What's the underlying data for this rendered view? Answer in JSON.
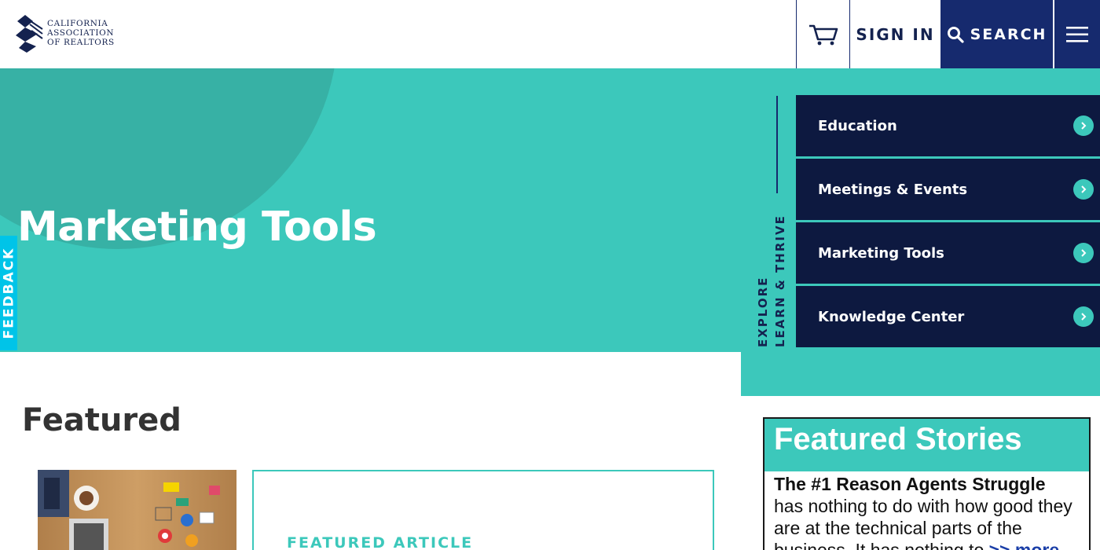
{
  "header": {
    "logo_lines": [
      "California",
      "Association",
      "of Realtors"
    ],
    "cart_icon": "shopping-cart-icon",
    "signin_label": "SIGN IN",
    "search_label": "SEARCH",
    "menu_icon": "hamburger-menu-icon"
  },
  "hero": {
    "title": "Marketing Tools",
    "feedback_label": "FEEDBACK",
    "explore_label": "EXPLORE",
    "learn_label": "LEARN & THRIVE",
    "menu": [
      {
        "label": "Education"
      },
      {
        "label": "Meetings & Events"
      },
      {
        "label": "Marketing Tools"
      },
      {
        "label": "Knowledge Center"
      }
    ]
  },
  "featured": {
    "heading": "Featured",
    "kicker": "FEATURED ARTICLE"
  },
  "stories": {
    "title": "Featured Stories",
    "lead": "The #1 Reason Agents Struggle",
    "text": "has nothing to do with how good they are at the technical parts of the business. It has nothing to",
    "more": ">> more"
  },
  "colors": {
    "navy": "#162a6e",
    "dark_navy": "#0d1940",
    "teal": "#3cc8bb",
    "feedback": "#00c4e8"
  }
}
